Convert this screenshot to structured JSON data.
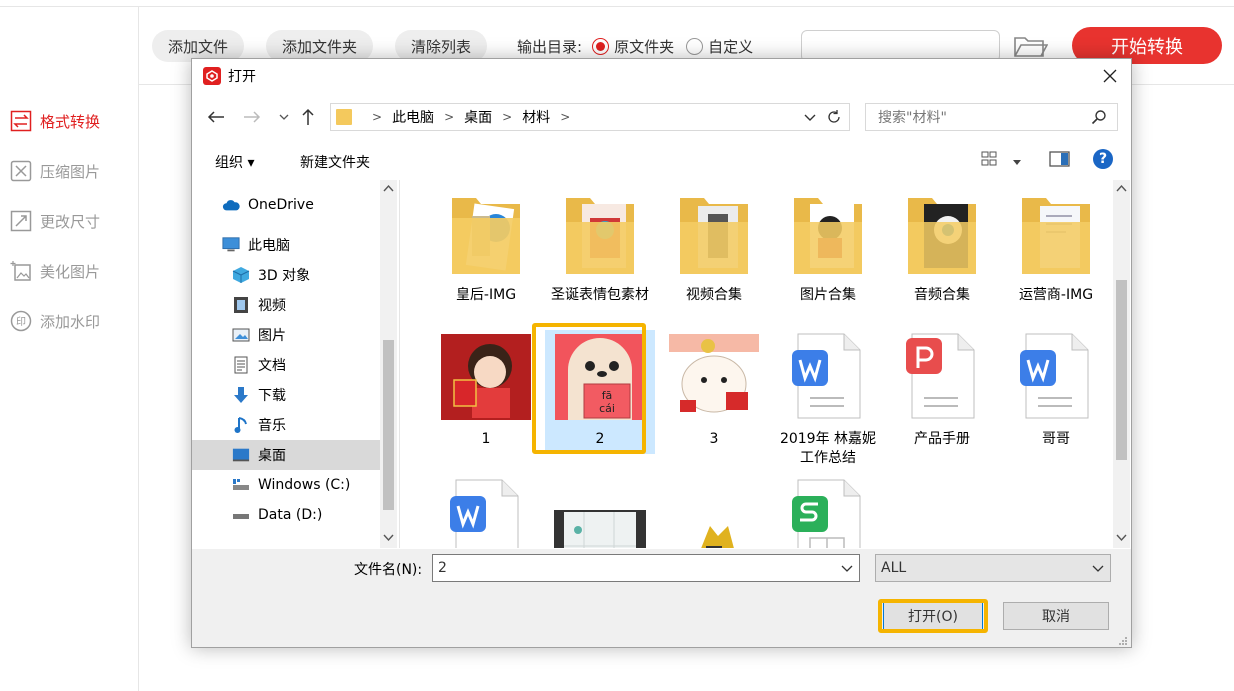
{
  "app": {
    "toolbar": {
      "add_file": "添加文件",
      "add_folder": "添加文件夹",
      "clear_list": "清除列表",
      "output_label": "输出目录:",
      "radio_original": "原文件夹",
      "radio_custom": "自定义",
      "path_value": "",
      "start": "开始转换"
    },
    "sidebar": [
      {
        "label": "格式转换",
        "icon": "convert-icon",
        "active": true
      },
      {
        "label": "压缩图片",
        "icon": "compress-icon",
        "active": false
      },
      {
        "label": "更改尺寸",
        "icon": "resize-icon",
        "active": false
      },
      {
        "label": "美化图片",
        "icon": "beautify-icon",
        "active": false
      },
      {
        "label": "添加水印",
        "icon": "watermark-icon",
        "active": false
      }
    ],
    "colors": {
      "accent": "#e8332f",
      "highlight": "#f5b400",
      "selection": "#cce8ff"
    }
  },
  "dialog": {
    "title": "打开",
    "breadcrumb": [
      "此电脑",
      "桌面",
      "材料"
    ],
    "search_placeholder": "搜索\"材料\"",
    "cmd_organize": "组织 ▾",
    "cmd_new_folder": "新建文件夹",
    "nav": [
      {
        "label": "OneDrive",
        "icon": "cloud-icon"
      },
      {
        "label": "此电脑",
        "icon": "computer-icon"
      },
      {
        "label": "3D 对象",
        "icon": "cube-icon"
      },
      {
        "label": "视频",
        "icon": "video-icon"
      },
      {
        "label": "图片",
        "icon": "picture-icon"
      },
      {
        "label": "文档",
        "icon": "document-icon"
      },
      {
        "label": "下载",
        "icon": "download-icon"
      },
      {
        "label": "音乐",
        "icon": "music-icon"
      },
      {
        "label": "桌面",
        "icon": "desktop-icon"
      },
      {
        "label": "Windows (C:)",
        "icon": "drive-c-icon"
      },
      {
        "label": "Data (D:)",
        "icon": "drive-d-icon"
      }
    ],
    "files": [
      {
        "label": "皇后-IMG",
        "kind": "folder"
      },
      {
        "label": "圣诞表情包素材",
        "kind": "folder"
      },
      {
        "label": "视频合集",
        "kind": "folder"
      },
      {
        "label": "图片合集",
        "kind": "folder"
      },
      {
        "label": "音频合集",
        "kind": "folder"
      },
      {
        "label": "运营商-IMG",
        "kind": "folder"
      },
      {
        "label": "1",
        "kind": "image"
      },
      {
        "label": "2",
        "kind": "image"
      },
      {
        "label": "3",
        "kind": "image"
      },
      {
        "label": "2019年 林嘉妮 工作总结",
        "kind": "word"
      },
      {
        "label": "产品手册",
        "kind": "ppt"
      },
      {
        "label": "哥哥",
        "kind": "word"
      },
      {
        "label": "",
        "kind": "word"
      },
      {
        "label": "",
        "kind": "video"
      },
      {
        "label": "",
        "kind": "image"
      },
      {
        "label": "",
        "kind": "sheet"
      }
    ],
    "sticker_text": {
      "line1": "fā",
      "line2": "cái"
    },
    "filename_label": "文件名(N):",
    "filename_value": "2",
    "filetype": "ALL",
    "open": "打开(O)",
    "cancel": "取消"
  }
}
